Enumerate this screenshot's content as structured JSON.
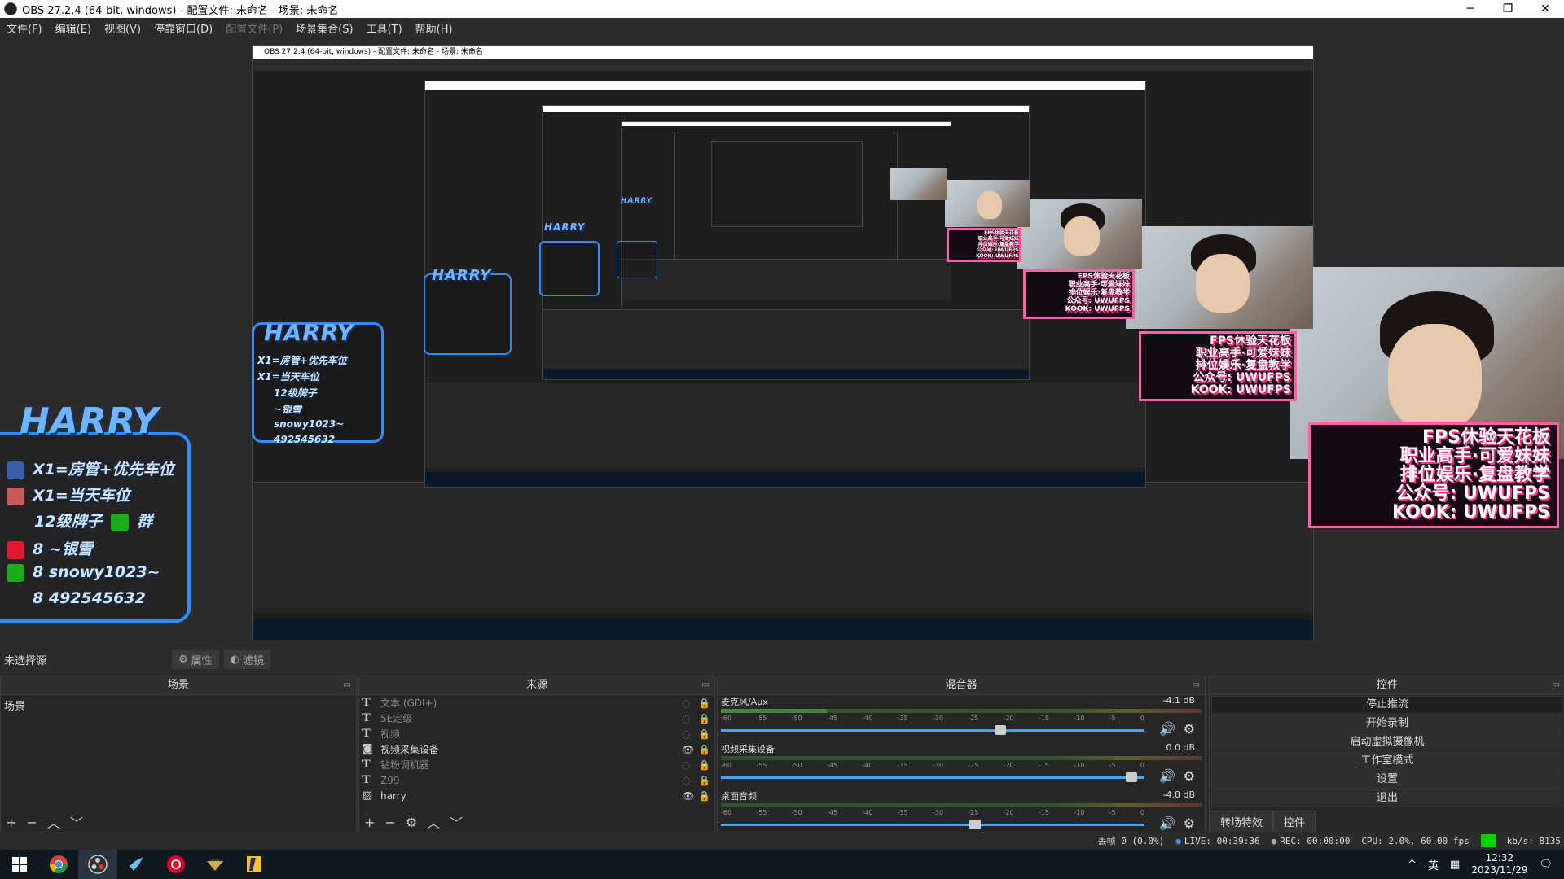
{
  "window": {
    "title": "OBS 27.2.4 (64-bit, windows) - 配置文件: 未命名 - 场景: 未命名",
    "minimize": "─",
    "restore": "❐",
    "close": "✕"
  },
  "menu": [
    "文件(F)",
    "编辑(E)",
    "视图(V)",
    "停靠窗口(D)",
    "配置文件(P)",
    "场景集合(S)",
    "工具(T)",
    "帮助(H)"
  ],
  "menu_disabled_index": 4,
  "overlay": {
    "logo": "HARRY",
    "lines": [
      "X1=房管+优先车位",
      "X1=当天车位",
      "12级牌子",
      "群",
      "~银雪",
      "snowy1023~",
      "492545632"
    ],
    "line_prefix": "8",
    "pink_lines": [
      "FPS休验天花板",
      "职业高手·可爱妹妹",
      "排位娱乐·复盘教学",
      "公众号: UWUFPS",
      "KOOK: UWUFPS"
    ]
  },
  "dockbar": {
    "label": "未选择源",
    "properties": "属性",
    "filters": "滤镜"
  },
  "docks": {
    "scenes": {
      "title": "场景",
      "items": [
        "场景"
      ]
    },
    "sources": {
      "title": "来源",
      "items": [
        {
          "type": "T",
          "name": "文本 (GDI+)",
          "visible": false
        },
        {
          "type": "T",
          "name": "5E定级",
          "visible": false
        },
        {
          "type": "T",
          "name": "视频",
          "visible": false
        },
        {
          "type": "cam",
          "name": "视频采集设备",
          "visible": true
        },
        {
          "type": "T",
          "name": "钻粉调机器",
          "visible": false
        },
        {
          "type": "T",
          "name": "Z99",
          "visible": false
        },
        {
          "type": "img",
          "name": "harry",
          "visible": true
        }
      ]
    },
    "mixer": {
      "title": "混音器",
      "ticks": [
        "-60",
        "-55",
        "-50",
        "-45",
        "-40",
        "-35",
        "-30",
        "-25",
        "-20",
        "-15",
        "-10",
        "-5",
        "0"
      ],
      "channels": [
        {
          "name": "麦克风/Aux",
          "db": "-4.1 dB",
          "level": 0.22,
          "fader": 0.66
        },
        {
          "name": "视频采集设备",
          "db": "0.0 dB",
          "level": 0.0,
          "fader": 0.97
        },
        {
          "name": "桌面音频",
          "db": "-4.8 dB",
          "level": 0.0,
          "fader": 0.6
        }
      ]
    },
    "controls": {
      "title": "控件",
      "buttons": [
        "停止推流",
        "开始录制",
        "启动虚拟摄像机",
        "工作室模式",
        "设置",
        "退出"
      ],
      "tabs": [
        "转场特效",
        "控件"
      ]
    }
  },
  "status": {
    "dropped": "丢帧 0 (0.0%)",
    "live": "LIVE: 00:39:36",
    "rec": "REC: 00:00:00",
    "cpu": "CPU: 2.0%, 60.00 fps",
    "kbps": "kb/s: 8135"
  },
  "taskbar": {
    "tray_caret": "^",
    "ime": "英",
    "time": "12:32",
    "date": "2023/11/29"
  }
}
